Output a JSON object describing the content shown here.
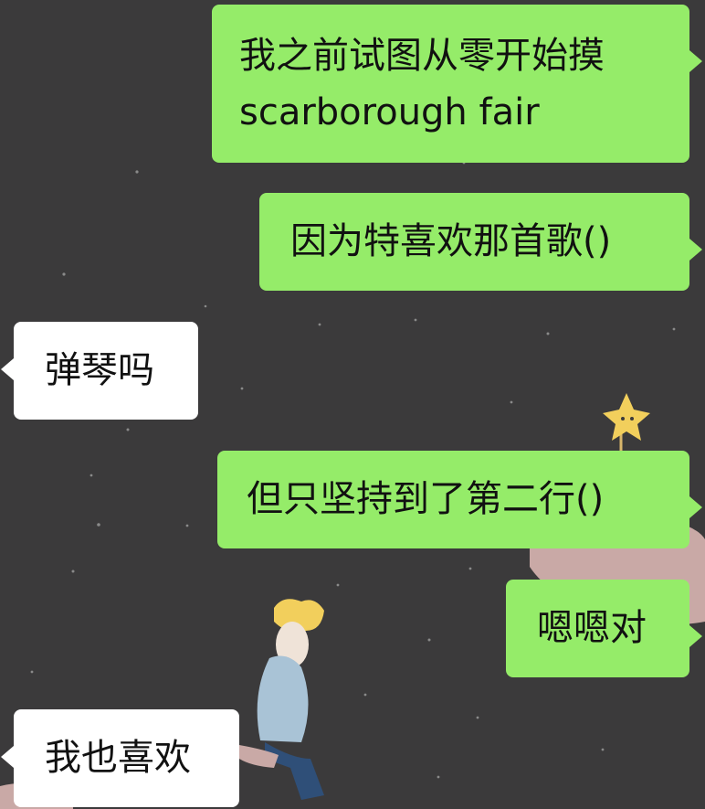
{
  "chat": {
    "background_color": "#3b3a3b",
    "sent_bubble_color": "#95ec69",
    "received_bubble_color": "#ffffff",
    "messages": [
      {
        "direction": "sent",
        "lines": [
          "我之前试图从零开始摸",
          "scarborough fair"
        ]
      },
      {
        "direction": "sent",
        "text": "因为特喜欢那首歌()"
      },
      {
        "direction": "received",
        "text": "弹琴吗"
      },
      {
        "direction": "sent",
        "text": "但只坚持到了第二行()"
      },
      {
        "direction": "sent",
        "text": "嗯嗯对"
      },
      {
        "direction": "received",
        "text": "我也喜欢"
      }
    ]
  }
}
